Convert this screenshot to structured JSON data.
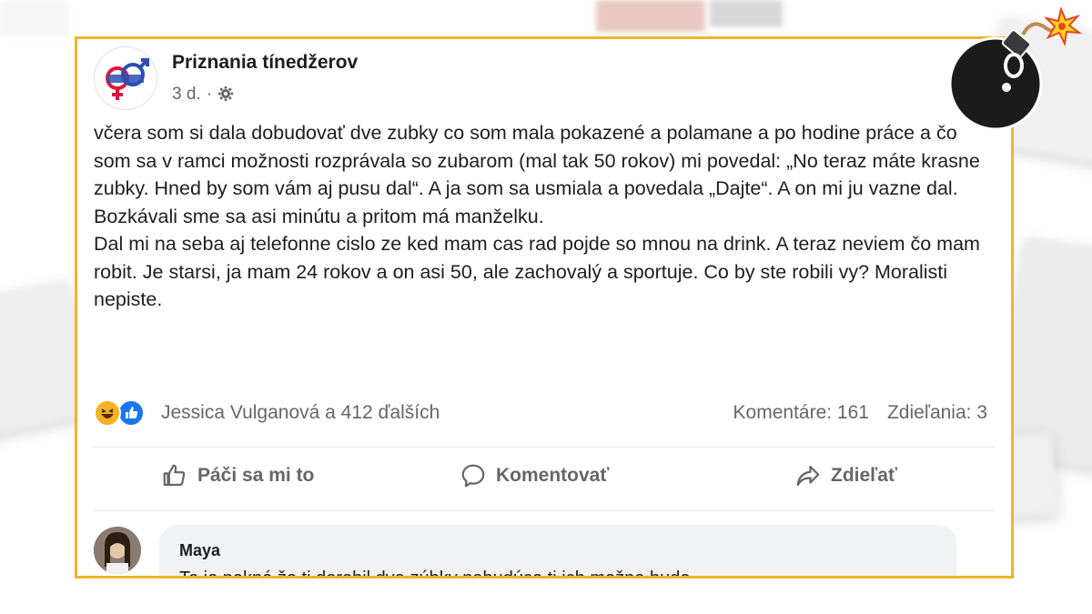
{
  "post": {
    "page_name": "Priznania tínedžerov",
    "time": "3 d.",
    "separator": "·",
    "privacy_icon": "gear-icon",
    "paragraphs": [
      "včera som si dala dobudovať dve zubky co som mala pokazené a polamane a po hodine práce a čo som sa v ramci možnosti rozprávala so zubarom (mal tak 50 rokov) mi povedal: „No teraz máte krasne zubky. Hned by som vám aj pusu dal“. A ja som sa usmiala a povedala „Dajte“. A on mi ju vazne dal. Bozkávali sme sa asi minútu a pritom má manželku.",
      "Dal mi na seba aj telefonne cislo ze ked mam cas rad pojde so mnou na drink. A teraz neviem čo mam robit. Je starsi, ja mam 24 rokov a on asi 50, ale zachovalý a sportuje. Co by ste robili vy? Moralisti nepiste."
    ],
    "reactions": {
      "icons": [
        "haha-icon",
        "like-icon"
      ],
      "names": "Jessica Vulganová a 412 ďalších",
      "comments": "Komentáre: 161",
      "shares": "Zdieľania: 3"
    },
    "actions": {
      "like": "Páči sa mi to",
      "comment": "Komentovať",
      "share": "Zdieľať"
    }
  },
  "comment": {
    "author": "Maya",
    "text": "To je pekné že ti dorobil dva zúbky nabudúce ti ich možno bude"
  },
  "colors": {
    "frame": "#f0b429",
    "text": "#1c1e21",
    "secondary": "#65676b",
    "like_blue": "#1877f2",
    "haha_yellow": "#f7b125"
  }
}
